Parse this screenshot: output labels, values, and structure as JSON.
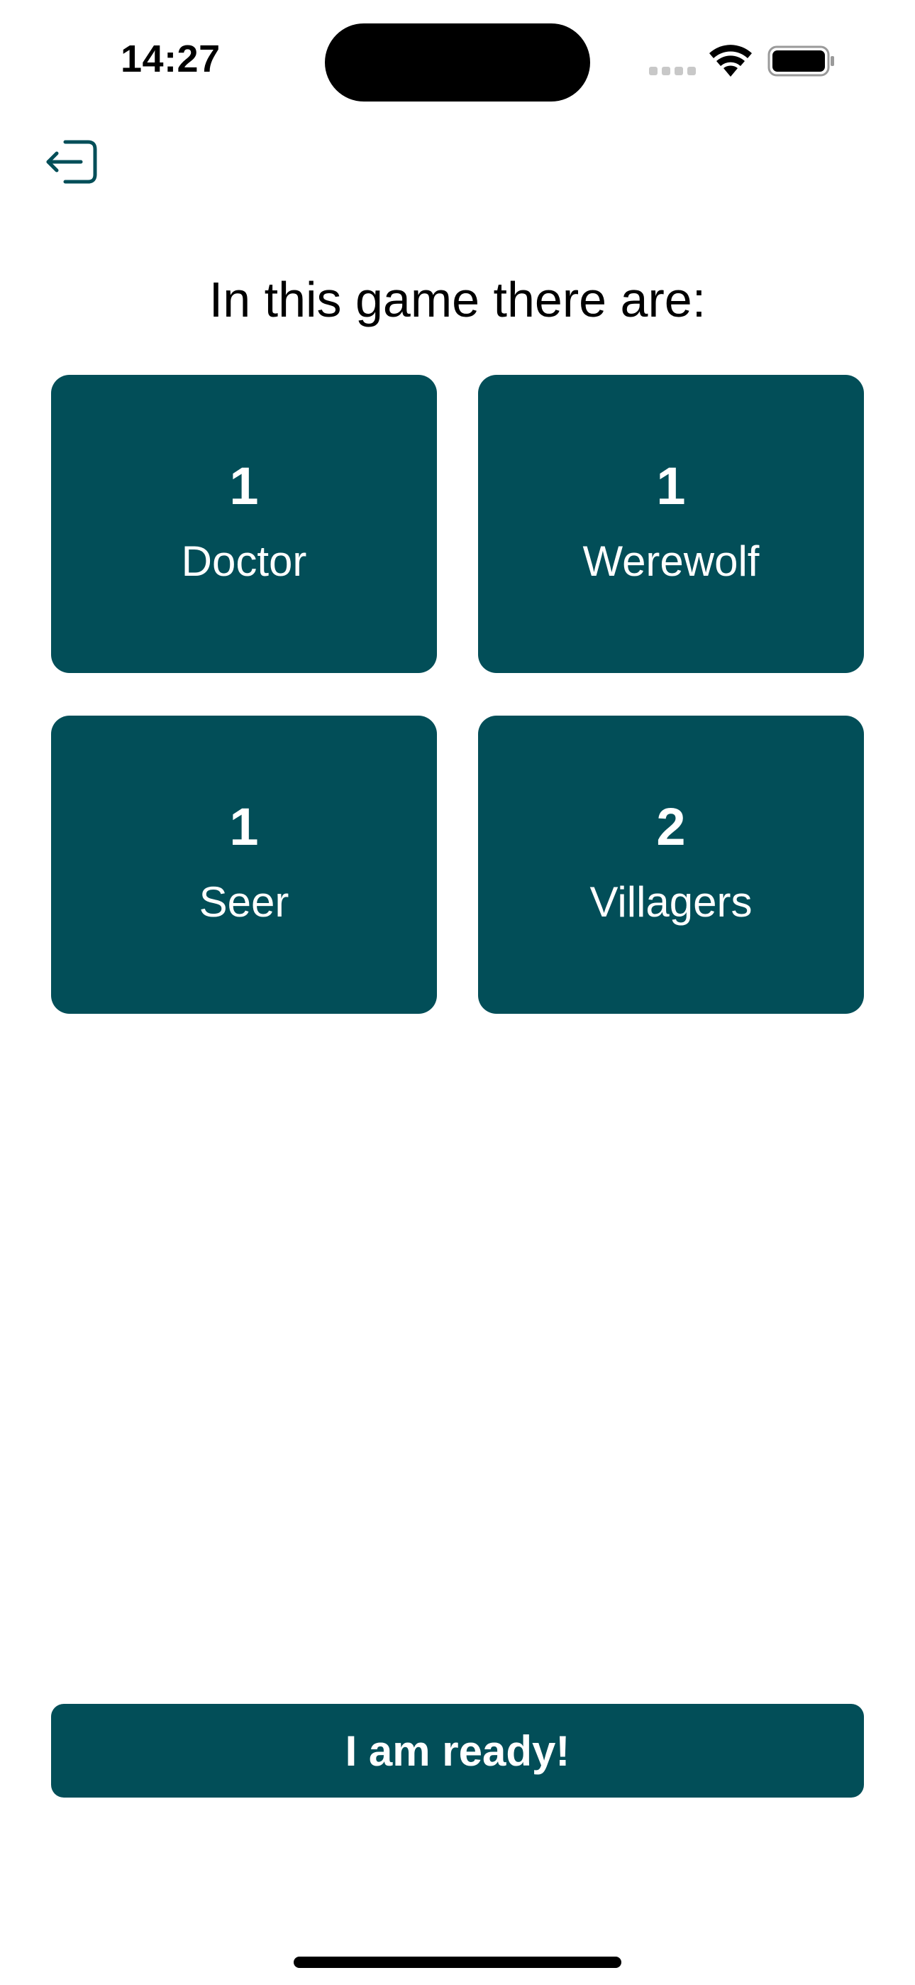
{
  "status_bar": {
    "time": "14:27",
    "icons": [
      "cellular-signal-icon",
      "wifi-icon",
      "battery-icon"
    ]
  },
  "nav": {
    "exit_icon": "exit-door-icon"
  },
  "heading": "In this game there are:",
  "roles": [
    {
      "count": "1",
      "name": "Doctor"
    },
    {
      "count": "1",
      "name": "Werewolf"
    },
    {
      "count": "1",
      "name": "Seer"
    },
    {
      "count": "2",
      "name": "Villagers"
    }
  ],
  "ready_button": {
    "label": "I am ready!"
  },
  "colors": {
    "accent": "#024e58",
    "background": "#ffffff",
    "card_text": "#ffffff"
  }
}
